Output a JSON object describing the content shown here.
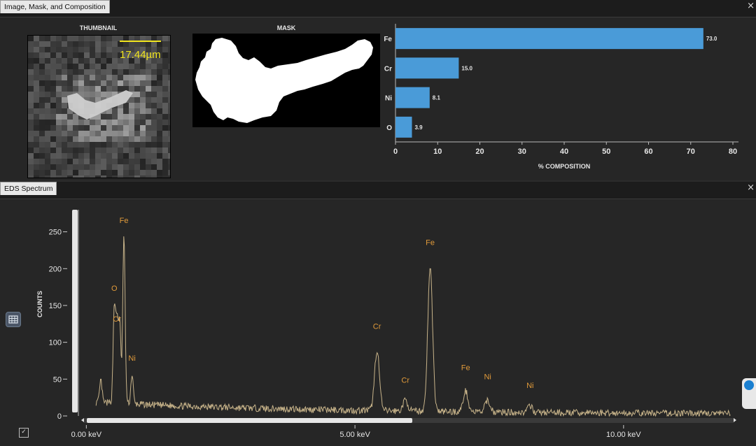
{
  "panels": {
    "top_tab": "Image, Mask, and Composition",
    "bottom_tab": "EDS Spectrum",
    "close_glyph": "×"
  },
  "thumbnail": {
    "header": "THUMBNAIL",
    "scale_label": "17.44µm"
  },
  "mask": {
    "header": "MASK"
  },
  "composition_chart": {
    "type": "bar",
    "categories": [
      "Fe",
      "Cr",
      "Ni",
      "O"
    ],
    "values": [
      73.0,
      15.0,
      8.1,
      3.9
    ],
    "value_labels": [
      "73.0",
      "15.0",
      "8.1",
      "3.9"
    ],
    "xlabel": "% COMPOSITION",
    "xlim": [
      0,
      80
    ],
    "ticks": [
      0,
      10,
      20,
      30,
      40,
      50,
      60,
      70,
      80
    ],
    "bar_color": "#4a9bd8"
  },
  "chart_data": {
    "type": "line",
    "xlabel": "keV",
    "ylabel": "COUNTS",
    "xlim": [
      -0.2,
      12.1
    ],
    "ylim": [
      0,
      280
    ],
    "yticks": [
      0,
      50,
      100,
      150,
      200,
      250
    ],
    "xticks": [
      0,
      5,
      10
    ],
    "xtick_labels": [
      "0.00 keV",
      "5.00 keV",
      "10.00 keV"
    ],
    "line_color": "#c8b48a",
    "label_color": "#e09a3a",
    "peaks": [
      {
        "x": 0.27,
        "y": 30
      },
      {
        "x": 0.52,
        "y": 130
      },
      {
        "x": 0.57,
        "y": 105
      },
      {
        "x": 0.62,
        "y": 110
      },
      {
        "x": 0.7,
        "y": 228
      },
      {
        "x": 0.85,
        "y": 40
      },
      {
        "x": 5.41,
        "y": 82
      },
      {
        "x": 5.94,
        "y": 15
      },
      {
        "x": 6.4,
        "y": 195
      },
      {
        "x": 7.06,
        "y": 28
      },
      {
        "x": 7.47,
        "y": 16
      },
      {
        "x": 8.26,
        "y": 8
      }
    ],
    "annotations": [
      {
        "text": "Fe",
        "x": 0.7,
        "y": 262
      },
      {
        "text": "O",
        "x": 0.52,
        "y": 170
      },
      {
        "text": "Cr",
        "x": 0.57,
        "y": 128
      },
      {
        "text": "Ni",
        "x": 0.85,
        "y": 75
      },
      {
        "text": "Cr",
        "x": 5.41,
        "y": 118
      },
      {
        "text": "Cr",
        "x": 5.94,
        "y": 45
      },
      {
        "text": "Fe",
        "x": 6.4,
        "y": 232
      },
      {
        "text": "Fe",
        "x": 7.06,
        "y": 62
      },
      {
        "text": "Ni",
        "x": 7.47,
        "y": 50
      },
      {
        "text": "Ni",
        "x": 8.26,
        "y": 38
      }
    ]
  },
  "icons": [
    "table-icon",
    "checkbox-icon",
    "right-dock-icon"
  ]
}
